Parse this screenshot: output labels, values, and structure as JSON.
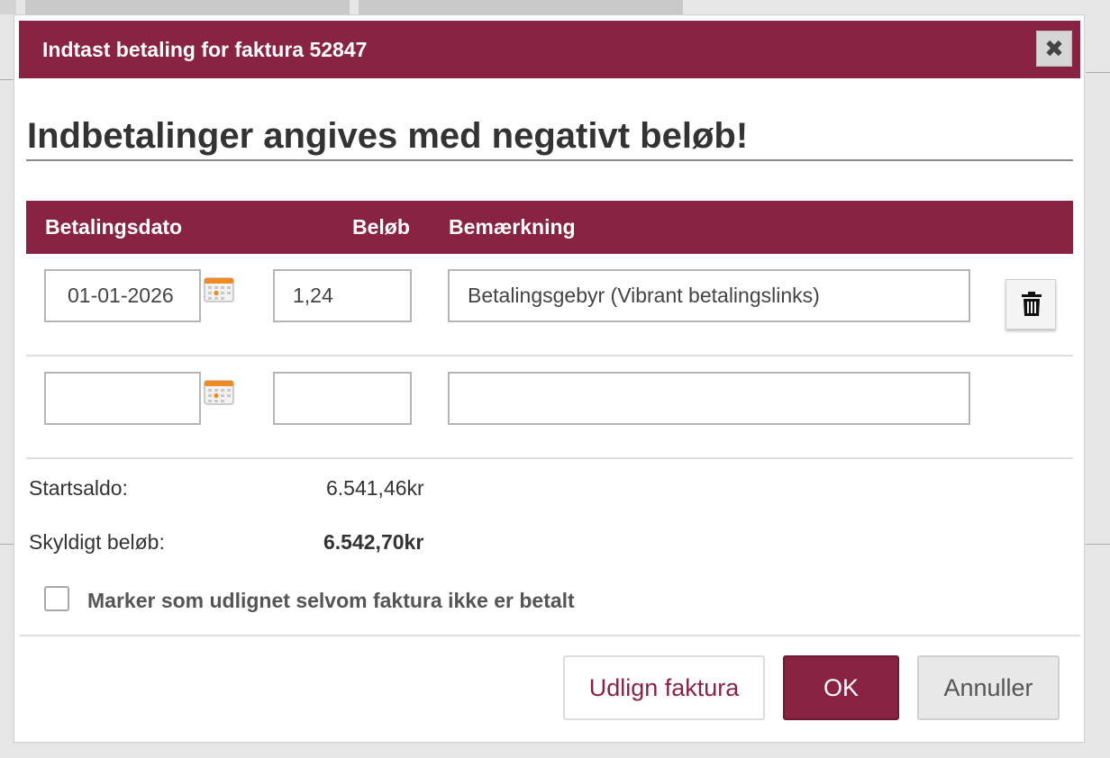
{
  "dialog": {
    "title": "Indtast betaling for faktura 52847",
    "close_symbol": "✖",
    "heading": "Indbetalinger angives med negativt beløb!"
  },
  "table": {
    "headers": {
      "date": "Betalingsdato",
      "amount": "Beløb",
      "note": "Bemærkning"
    },
    "rows": [
      {
        "date": "01-01-2026",
        "amount": "1,24",
        "note": "Betalingsgebyr (Vibrant betalingslinks)"
      },
      {
        "date": "",
        "amount": "",
        "note": ""
      }
    ]
  },
  "summary": {
    "start_label": "Startsaldo:",
    "start_value": "6.541,46kr",
    "owed_label": "Skyldigt beløb:",
    "owed_value": "6.542,70kr"
  },
  "checkbox": {
    "label": "Marker som udlignet selvom faktura ikke er betalt",
    "checked": false
  },
  "buttons": {
    "udlign": "Udlign faktura",
    "ok": "OK",
    "cancel": "Annuller"
  },
  "colors": {
    "accent": "#882342",
    "calendar_accent": "#f08a24"
  },
  "icons": {
    "close": "close-icon",
    "calendar": "calendar-icon",
    "delete": "trash-icon"
  }
}
